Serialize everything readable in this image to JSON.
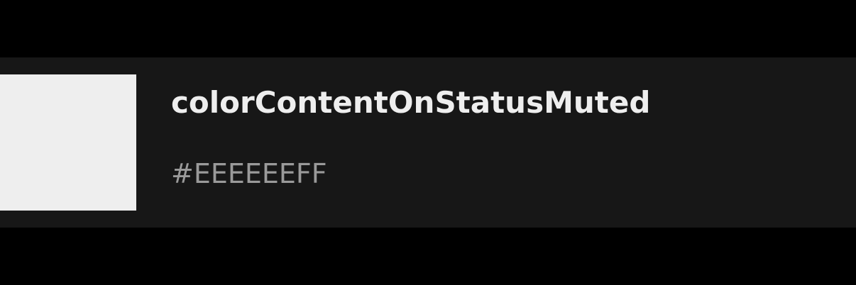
{
  "token": {
    "name": "colorContentOnStatusMuted",
    "value": "#EEEEEEFF",
    "swatch_color": "#EEEEEE"
  },
  "colors": {
    "page_background": "#000000",
    "row_background": "#171717",
    "name_text": "#EEEEEE",
    "value_text": "#9A9A9A"
  }
}
